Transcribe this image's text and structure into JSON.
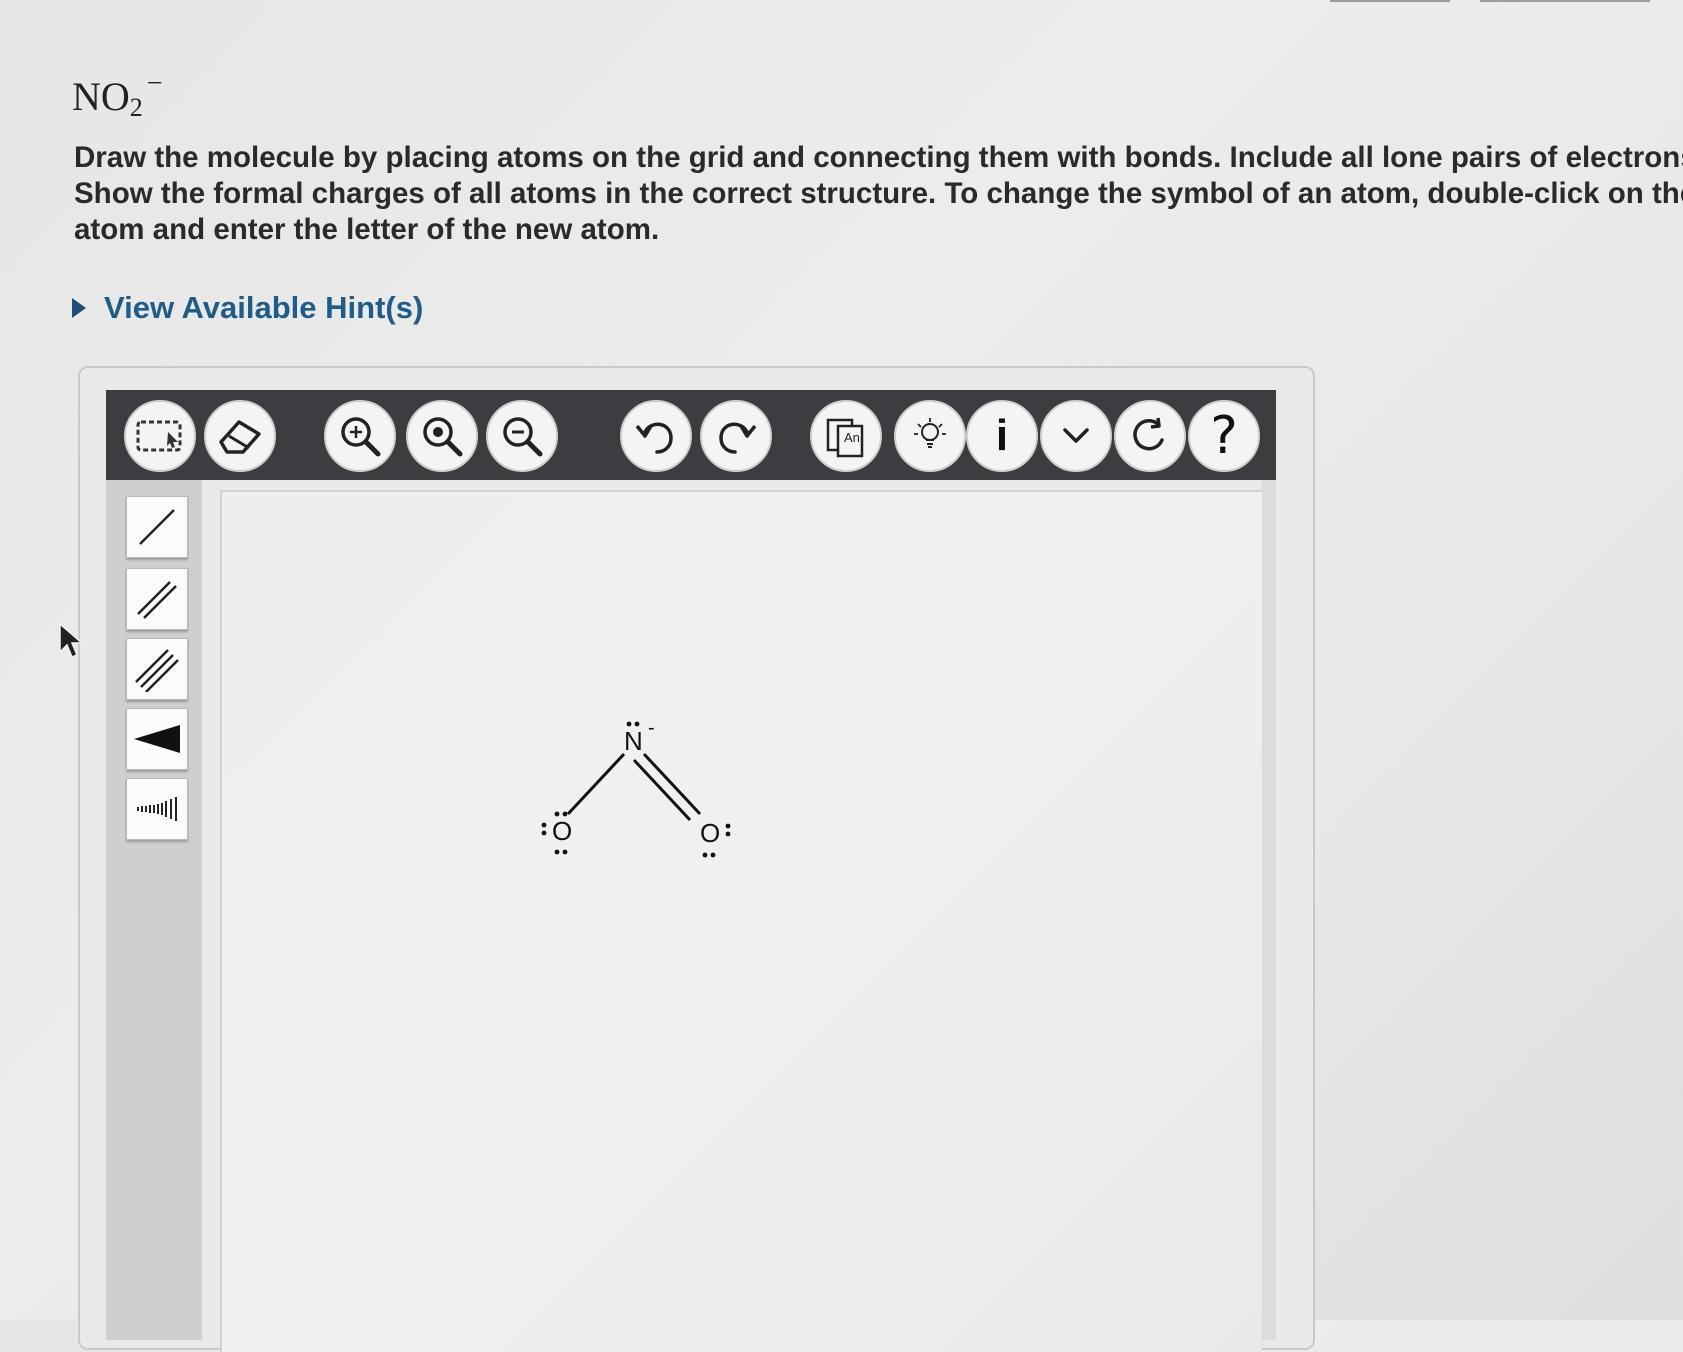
{
  "question": {
    "formula": {
      "base": "NO",
      "subscript": "2",
      "charge": "−"
    },
    "instructions": [
      "Draw the molecule by placing atoms on the grid and connecting them with bonds. Include all lone pairs of electrons.",
      "Show the formal charges of all  atoms in the correct structure. To change the symbol of an atom, double-click on the",
      "atom and enter the letter of the new atom."
    ],
    "hint_link": "View Available Hint(s)"
  },
  "toolbar": {
    "buttons": [
      {
        "name": "select-tool-button",
        "icon": "marquee-select-icon"
      },
      {
        "name": "erase-tool-button",
        "icon": "eraser-icon"
      },
      {
        "name": "zoom-in-button",
        "icon": "zoom-in-icon"
      },
      {
        "name": "zoom-reset-button",
        "icon": "zoom-fit-icon"
      },
      {
        "name": "zoom-out-button",
        "icon": "zoom-out-icon"
      },
      {
        "name": "undo-button",
        "icon": "undo-icon"
      },
      {
        "name": "redo-button",
        "icon": "redo-icon"
      },
      {
        "name": "templates-button",
        "icon": "copy-template-icon",
        "label": "An"
      },
      {
        "name": "clean-structure-button",
        "icon": "lightbulb-icon"
      },
      {
        "name": "info-button",
        "icon": "info-icon",
        "label": "i"
      },
      {
        "name": "more-button",
        "icon": "chevron-down-icon"
      },
      {
        "name": "reset-button",
        "icon": "reset-icon"
      },
      {
        "name": "help-button",
        "icon": "question-icon",
        "label": "?"
      }
    ]
  },
  "bond_tools": [
    {
      "name": "single-bond-tool",
      "icon": "single-bond-icon"
    },
    {
      "name": "double-bond-tool",
      "icon": "double-bond-icon"
    },
    {
      "name": "triple-bond-tool",
      "icon": "triple-bond-icon"
    },
    {
      "name": "wedge-bond-tool",
      "icon": "wedge-bond-icon"
    },
    {
      "name": "hash-bond-tool",
      "icon": "hash-bond-icon"
    }
  ],
  "molecule": {
    "atoms": [
      {
        "symbol": "N",
        "charge": "-"
      },
      {
        "symbol": "O",
        "charge": ""
      },
      {
        "symbol": "O",
        "charge": ""
      }
    ],
    "bonds": [
      {
        "from": "N",
        "to": "O (left)",
        "order": 1
      },
      {
        "from": "N",
        "to": "O (right)",
        "order": 2
      }
    ]
  },
  "colors": {
    "hint_link": "#1e5d8a",
    "toolbar_bg": "#3b3d41",
    "text": "#2a2a2a"
  }
}
